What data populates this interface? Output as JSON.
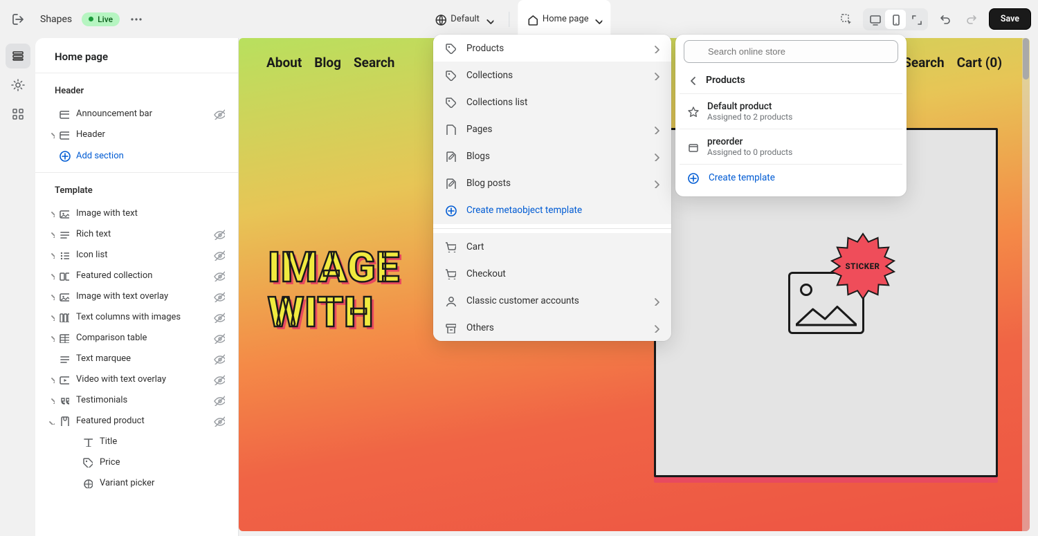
{
  "topbar": {
    "store_name": "Shapes",
    "status_label": "Live",
    "locale_label": "Default",
    "page_label": "Home page",
    "save_label": "Save"
  },
  "sidebar": {
    "title": "Home page",
    "header_group_label": "Header",
    "template_group_label": "Template",
    "add_section_label": "Add section",
    "header_items": [
      {
        "label": "Announcement bar",
        "hidden": true,
        "expandable": false,
        "icon": "section"
      },
      {
        "label": "Header",
        "hidden": false,
        "expandable": true,
        "icon": "section"
      }
    ],
    "template_items": [
      {
        "label": "Image with text",
        "hidden": false,
        "expandable": true,
        "icon": "media"
      },
      {
        "label": "Rich text",
        "hidden": true,
        "expandable": true,
        "icon": "text"
      },
      {
        "label": "Icon list",
        "hidden": true,
        "expandable": true,
        "icon": "list"
      },
      {
        "label": "Featured collection",
        "hidden": true,
        "expandable": true,
        "icon": "cards"
      },
      {
        "label": "Image with text overlay",
        "hidden": true,
        "expandable": true,
        "icon": "media"
      },
      {
        "label": "Text columns with images",
        "hidden": true,
        "expandable": true,
        "icon": "columns"
      },
      {
        "label": "Comparison table",
        "hidden": true,
        "expandable": true,
        "icon": "table"
      },
      {
        "label": "Text marquee",
        "hidden": true,
        "expandable": false,
        "icon": "text"
      },
      {
        "label": "Video with text overlay",
        "hidden": true,
        "expandable": true,
        "icon": "video"
      },
      {
        "label": "Testimonials",
        "hidden": true,
        "expandable": true,
        "icon": "quotes"
      },
      {
        "label": "Featured product",
        "hidden": true,
        "expandable": true,
        "expanded": true,
        "icon": "product",
        "children": [
          {
            "label": "Title",
            "icon": "type"
          },
          {
            "label": "Price",
            "icon": "tag"
          },
          {
            "label": "Variant picker",
            "icon": "swatch"
          }
        ]
      }
    ]
  },
  "menu1": {
    "items": [
      {
        "label": "Products",
        "icon": "tag",
        "chev": true,
        "selected": true
      },
      {
        "label": "Collections",
        "icon": "tag",
        "chev": true
      },
      {
        "label": "Collections list",
        "icon": "tag",
        "chev": false
      },
      {
        "label": "Pages",
        "icon": "page",
        "chev": true
      },
      {
        "label": "Blogs",
        "icon": "blog",
        "chev": true
      },
      {
        "label": "Blog posts",
        "icon": "blog",
        "chev": true
      }
    ],
    "create_label": "Create metaobject template",
    "items2": [
      {
        "label": "Cart",
        "icon": "cart",
        "chev": false
      },
      {
        "label": "Checkout",
        "icon": "cart",
        "chev": false
      },
      {
        "label": "Classic customer accounts",
        "icon": "user",
        "chev": true
      },
      {
        "label": "Others",
        "icon": "archive",
        "chev": true
      }
    ]
  },
  "menu2": {
    "search_placeholder": "Search online store",
    "crumb": "Products",
    "templates": [
      {
        "title": "Default product",
        "sub": "Assigned to 2 products",
        "icon": "star",
        "active": true
      },
      {
        "title": "preorder",
        "sub": "Assigned to 0 products",
        "icon": "box",
        "active": false
      }
    ],
    "create_label": "Create template"
  },
  "preview": {
    "nav_left": [
      "About",
      "Blog",
      "Search"
    ],
    "nav_right_search": "Search",
    "nav_right_cart": "Cart (0)",
    "hero_line1": "IMAGE",
    "hero_line2": "WITH",
    "sticker_label": "STICKER"
  }
}
